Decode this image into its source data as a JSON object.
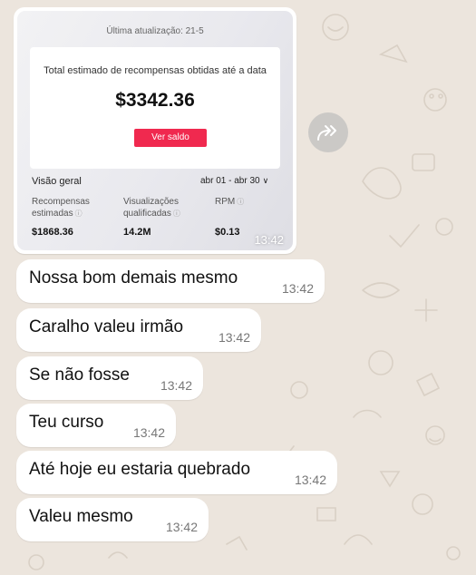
{
  "forward_icon": "share-forward-icon",
  "image_message": {
    "screenshot": {
      "updated": "Última atualização: 21-5",
      "estimate_label": "Total estimado de recompensas obtidas até a data",
      "estimate_amount": "$3342.36",
      "button_label": "Ver saldo",
      "button_color": "#f0294f",
      "overview_label": "Visão geral",
      "date_range": "abr 01 - abr 30",
      "metrics": [
        {
          "label_line1": "Recompensas",
          "label_line2": "estimadas",
          "value": "$1868.36"
        },
        {
          "label_line1": "Visualizações",
          "label_line2": "qualificadas",
          "value": "14.2M"
        },
        {
          "label_line1": "RPM",
          "label_line2": "",
          "value": "$0.13"
        }
      ]
    },
    "time": "13:42"
  },
  "messages": [
    {
      "text": "Nossa bom demais mesmo",
      "time": "13:42"
    },
    {
      "text": "Caralho valeu irmão",
      "time": "13:42"
    },
    {
      "text": "Se não fosse",
      "time": "13:42"
    },
    {
      "text": "Teu curso",
      "time": "13:42"
    },
    {
      "text": "Até hoje eu estaria quebrado",
      "time": "13:42"
    },
    {
      "text": "Valeu mesmo",
      "time": "13:42"
    }
  ],
  "colors": {
    "background": "#ece5dd",
    "bubble": "#ffffff",
    "timestamp": "#777777"
  }
}
